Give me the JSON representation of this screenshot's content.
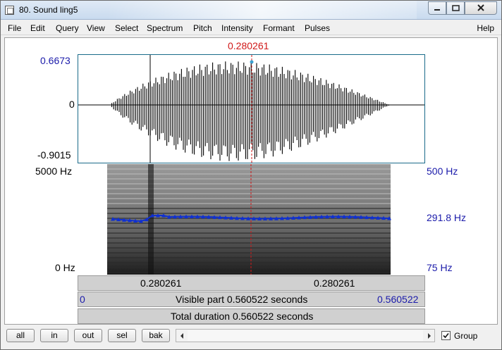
{
  "window": {
    "title": "80. Sound ling5"
  },
  "menu": {
    "items": [
      "File",
      "Edit",
      "Query",
      "View",
      "Select",
      "Spectrum",
      "Pitch",
      "Intensity",
      "Formant",
      "Pulses"
    ],
    "help": "Help"
  },
  "cursor": {
    "time_label": "0.280261"
  },
  "waveform": {
    "y_max": "0.6673",
    "y_zero": "0",
    "y_min": "-0.9015"
  },
  "spectrogram": {
    "freq_max": "5000 Hz",
    "freq_min": "0 Hz"
  },
  "pitch": {
    "top": "500 Hz",
    "current": "291.8 Hz",
    "bottom": "75 Hz"
  },
  "segments": {
    "left": "0.280261",
    "right": "0.280261"
  },
  "visible": {
    "start": "0",
    "label": "Visible part 0.560522 seconds",
    "end": "0.560522"
  },
  "total": {
    "label": "Total duration 0.560522 seconds"
  },
  "buttons": {
    "all": "all",
    "in": "in",
    "out": "out",
    "sel": "sel",
    "bak": "bak"
  },
  "group": {
    "label": "Group",
    "checked": true
  },
  "colors": {
    "cursor": "#d01818",
    "axis_blue": "#1a1aaa",
    "pitch": "#1030d0"
  }
}
